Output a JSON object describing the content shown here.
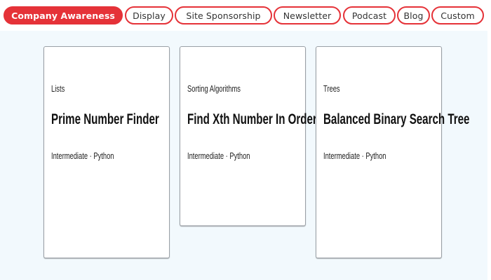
{
  "tabs": [
    {
      "label": "Company Awareness",
      "active": true
    },
    {
      "label": "Display",
      "active": false
    },
    {
      "label": "Site Sponsorship",
      "active": false
    },
    {
      "label": "Newsletter",
      "active": false
    },
    {
      "label": "Podcast",
      "active": false
    },
    {
      "label": "Blog",
      "active": false
    },
    {
      "label": "Custom",
      "active": false
    }
  ],
  "colors": {
    "accent": "#e53238",
    "content_bg": "#f2f9fd"
  },
  "cards": [
    {
      "category": "Lists",
      "title": "Prime Number Finder",
      "meta": "Intermediate · Python"
    },
    {
      "category": "Sorting Algorithms",
      "title": "Find Xth Number In Order",
      "meta": "Intermediate · Python"
    },
    {
      "category": "Trees",
      "title": "Balanced Binary Search Tree",
      "meta": "Intermediate · Python"
    }
  ]
}
